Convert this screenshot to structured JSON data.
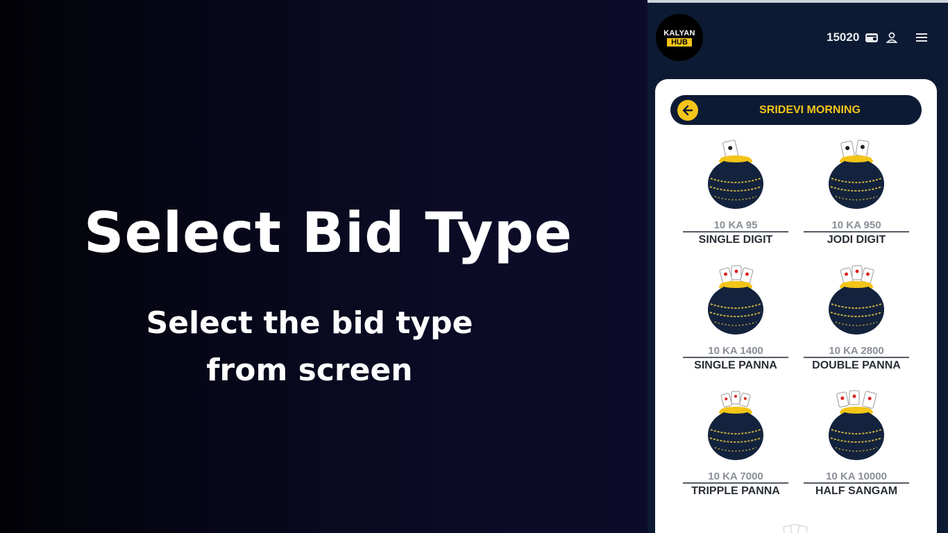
{
  "promo": {
    "title": "Select Bid Type",
    "subtitle": "Select the bid type from screen"
  },
  "app": {
    "logo_top": "KALYAN",
    "logo_bottom": "HUB",
    "balance": "15020",
    "icons": [
      "wallet-icon",
      "user-icon",
      "menu-icon",
      "back-arrow-icon"
    ]
  },
  "market": {
    "title": "SRIDEVI MORNING"
  },
  "bid_types": [
    {
      "rate": "10 KA 95",
      "name": "SINGLE DIGIT",
      "icon": "pot-icon"
    },
    {
      "rate": "10 KA 950",
      "name": "JODI DIGIT",
      "icon": "pot-icon"
    },
    {
      "rate": "10 KA 1400",
      "name": "SINGLE PANNA",
      "icon": "pot-icon"
    },
    {
      "rate": "10 KA 2800",
      "name": "DOUBLE PANNA",
      "icon": "pot-icon"
    },
    {
      "rate": "10 KA 7000",
      "name": "TRIPPLE PANNA",
      "icon": "pot-icon"
    },
    {
      "rate": "10 KA 10000",
      "name": "HALF SANGAM",
      "icon": "pot-icon"
    }
  ],
  "colors": {
    "accent": "#f3c519",
    "navy": "#0d1a33",
    "pot": "#14233d"
  }
}
